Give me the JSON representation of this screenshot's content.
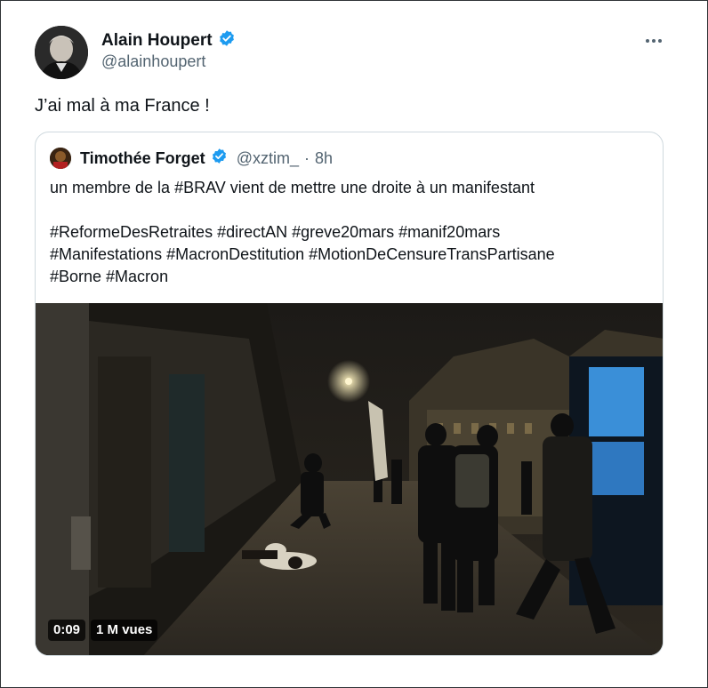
{
  "author": {
    "name": "Alain Houpert",
    "handle": "@alainhoupert",
    "verified": true
  },
  "tweet": {
    "text": "J’ai mal à ma France !"
  },
  "quoted": {
    "name": "Timothée Forget",
    "handle": "@xztim_",
    "separator": "·",
    "time": "8h",
    "line1": "un membre de la #BRAV vient de mettre une droite à un manifestant",
    "line2": "#ReformeDesRetraites #directAN #greve20mars #manif20mars",
    "line3": "#Manifestations #MacronDestitution #MotionDeCensureTransPartisane",
    "line4": "#Borne #Macron",
    "video": {
      "duration": "0:09",
      "views": "1 M vues"
    }
  },
  "colors": {
    "verified": "#1d9bf0",
    "text": "#0f1419",
    "secondary": "#536471",
    "border": "#cfd9de"
  }
}
